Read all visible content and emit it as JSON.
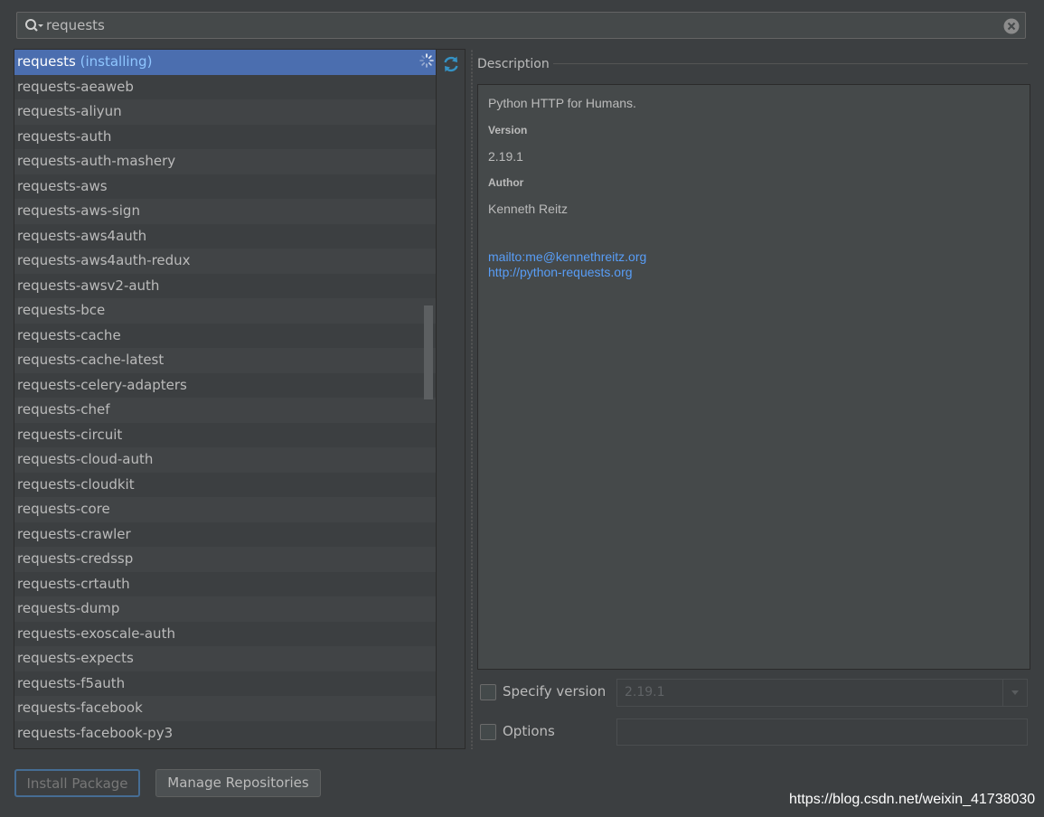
{
  "search": {
    "value": "requests"
  },
  "packages": {
    "selected_name": "requests",
    "selected_status": "(installing)",
    "items": [
      "requests-aeaweb",
      "requests-aliyun",
      "requests-auth",
      "requests-auth-mashery",
      "requests-aws",
      "requests-aws-sign",
      "requests-aws4auth",
      "requests-aws4auth-redux",
      "requests-awsv2-auth",
      "requests-bce",
      "requests-cache",
      "requests-cache-latest",
      "requests-celery-adapters",
      "requests-chef",
      "requests-circuit",
      "requests-cloud-auth",
      "requests-cloudkit",
      "requests-core",
      "requests-crawler",
      "requests-credssp",
      "requests-crtauth",
      "requests-dump",
      "requests-exoscale-auth",
      "requests-expects",
      "requests-f5auth",
      "requests-facebook",
      "requests-facebook-py3"
    ]
  },
  "description": {
    "label": "Description",
    "summary": "Python HTTP for Humans.",
    "version_heading": "Version",
    "version": "2.19.1",
    "author_heading": "Author",
    "author": "Kenneth Reitz",
    "email_link": "mailto:me@kennethreitz.org",
    "home_link": "http://python-requests.org"
  },
  "options": {
    "specify_version_label": "Specify version",
    "specify_version_value": "2.19.1",
    "options_label": "Options",
    "options_value": ""
  },
  "buttons": {
    "install": "Install Package",
    "manage": "Manage Repositories"
  },
  "watermark": "https://blog.csdn.net/weixin_41738030",
  "colors": {
    "background": "#3c3f41",
    "selection": "#4b6eaf",
    "link": "#589df6",
    "installing_status": "#8fc6ff"
  }
}
